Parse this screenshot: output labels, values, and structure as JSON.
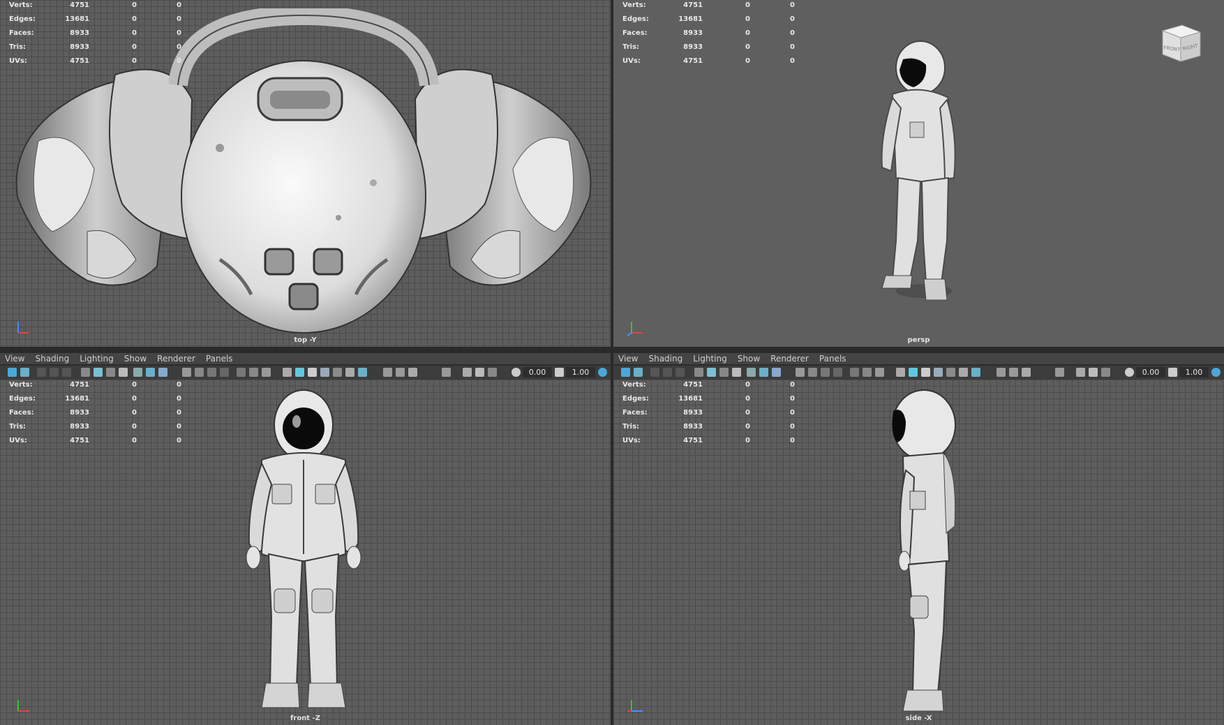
{
  "stats": [
    {
      "label": "Verts:",
      "v1": "4751",
      "v2": "0",
      "v3": "0"
    },
    {
      "label": "Edges:",
      "v1": "13681",
      "v2": "0",
      "v3": "0"
    },
    {
      "label": "Faces:",
      "v1": "8933",
      "v2": "0",
      "v3": "0"
    },
    {
      "label": "Tris:",
      "v1": "8933",
      "v2": "0",
      "v3": "0"
    },
    {
      "label": "UVs:",
      "v1": "4751",
      "v2": "0",
      "v3": "0"
    }
  ],
  "viewports": {
    "top": {
      "camera": "top -Y"
    },
    "persp": {
      "camera": "persp"
    },
    "front": {
      "camera": "front -Z"
    },
    "side": {
      "camera": "side -X"
    }
  },
  "menu": [
    "View",
    "Shading",
    "Lighting",
    "Show",
    "Renderer",
    "Panels"
  ],
  "toolbar": {
    "exposure": "0.00",
    "gamma": "1.00"
  },
  "viewcube": {
    "front": "FRONT",
    "right": "RIGHT"
  },
  "colors": {
    "accent": "#5ec8e0",
    "grid_bg": "#5d5d5d",
    "flat_bg": "#5f5f5f",
    "menubar": "#444444",
    "toolbar": "#3c3c3c"
  }
}
